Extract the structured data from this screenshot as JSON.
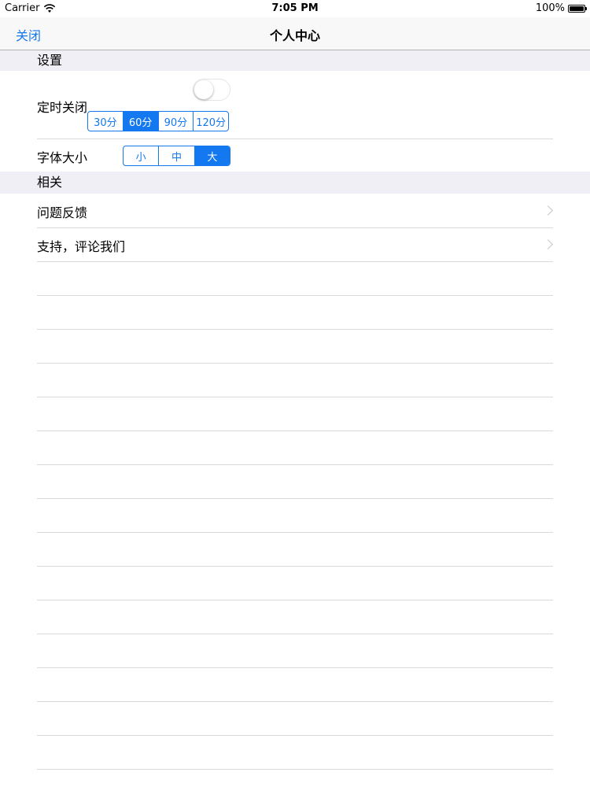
{
  "status_bar": {
    "carrier": "Carrier",
    "time": "7:05 PM",
    "battery": "100%",
    "battery_level": 1.0
  },
  "nav": {
    "close_label": "关闭",
    "title": "个人中心"
  },
  "settings": {
    "header": "设置",
    "timer_label": "定时关闭",
    "timer_switch_on": false,
    "timer_options": [
      "30分",
      "60分",
      "90分",
      "120分"
    ],
    "timer_selected": "60分",
    "font_label": "字体大小",
    "font_options": [
      "小",
      "中",
      "大"
    ],
    "font_selected": "大"
  },
  "related": {
    "header": "相关",
    "items": [
      {
        "label": "问题反馈"
      },
      {
        "label": "支持，评论我们"
      }
    ]
  },
  "colors": {
    "accent": "#1478f0",
    "section_bg": "#f0eff5",
    "separator": "#d9d9d9"
  }
}
